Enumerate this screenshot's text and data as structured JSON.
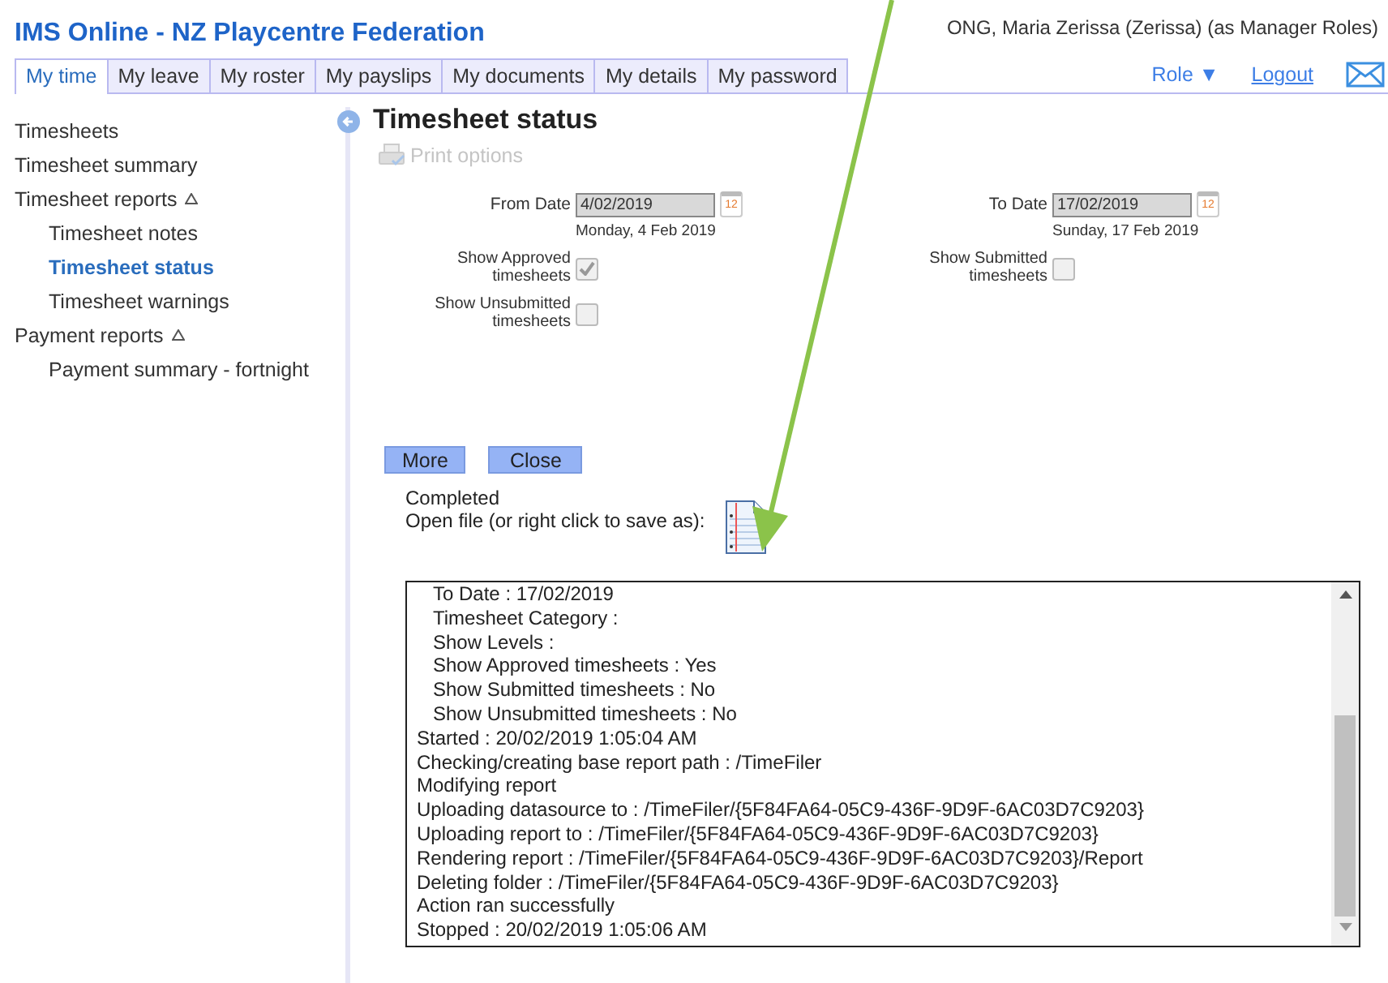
{
  "app_title": "IMS Online - NZ Playcentre Federation",
  "user": "ONG, Maria Zerissa (Zerissa) (as Manager Roles)",
  "tabs": [
    {
      "label": "My time",
      "selected": true
    },
    {
      "label": "My leave",
      "selected": false
    },
    {
      "label": "My roster",
      "selected": false
    },
    {
      "label": "My payslips",
      "selected": false
    },
    {
      "label": "My documents",
      "selected": false
    },
    {
      "label": "My details",
      "selected": false
    },
    {
      "label": "My password",
      "selected": false
    }
  ],
  "role_menu": {
    "label": "Role",
    "caret": "▼"
  },
  "logout": "Logout",
  "sidebar": {
    "items": [
      {
        "label": "Timesheets",
        "selected": false
      },
      {
        "label": "Timesheet summary",
        "selected": false
      },
      {
        "label": "Timesheet reports",
        "selected": false,
        "expanded": true,
        "children": [
          {
            "label": "Timesheet notes",
            "selected": false
          },
          {
            "label": "Timesheet status",
            "selected": true
          },
          {
            "label": "Timesheet warnings",
            "selected": false
          }
        ]
      },
      {
        "label": "Payment reports",
        "selected": false,
        "expanded": true,
        "children": [
          {
            "label": "Payment summary - fortnight",
            "selected": false
          }
        ]
      }
    ]
  },
  "page_title": "Timesheet status",
  "print_options": {
    "label": "Print options",
    "disabled": true
  },
  "form": {
    "from_date": {
      "label": "From Date",
      "value": "4/02/2019",
      "day": "Monday, 4 Feb 2019",
      "calendar": "12"
    },
    "to_date": {
      "label": "To Date",
      "value": "17/02/2019",
      "day": "Sunday, 17 Feb 2019",
      "calendar": "12"
    },
    "left_checkboxes": [
      {
        "label": "Show Approved timesheets",
        "checked": true,
        "disabled": true
      },
      {
        "label": "Show Unsubmitted timesheets",
        "checked": false,
        "disabled": true
      }
    ],
    "right_checkboxes": [
      {
        "label": "Show Submitted timesheets",
        "checked": false,
        "disabled": true
      }
    ]
  },
  "buttons": [
    "More",
    "Close"
  ],
  "status": "Completed",
  "open_file": "Open file (or right click to save as):",
  "log": [
    {
      "kind": "param",
      "text": "To Date : 17/02/2019"
    },
    {
      "kind": "param",
      "text": "Timesheet Category :"
    },
    {
      "kind": "param",
      "text": "Show Levels :"
    },
    {
      "kind": "param",
      "text": "Show Approved timesheets : Yes"
    },
    {
      "kind": "param",
      "text": "Show Submitted timesheets : No"
    },
    {
      "kind": "param",
      "text": "Show Unsubmitted timesheets : No"
    },
    {
      "kind": "step",
      "text": "Started : 20/02/2019 1:05:04 AM"
    },
    {
      "kind": "step",
      "text": "Checking/creating base report path : /TimeFiler"
    },
    {
      "kind": "step",
      "text": "Modifying report"
    },
    {
      "kind": "step",
      "text": "Uploading datasource to : /TimeFiler/{5F84FA64-05C9-436F-9D9F-6AC03D7C9203}"
    },
    {
      "kind": "step",
      "text": "Uploading report to : /TimeFiler/{5F84FA64-05C9-436F-9D9F-6AC03D7C9203}"
    },
    {
      "kind": "step",
      "text": "Rendering report : /TimeFiler/{5F84FA64-05C9-436F-9D9F-6AC03D7C9203}/Report"
    },
    {
      "kind": "step",
      "text": "Deleting folder : /TimeFiler/{5F84FA64-05C9-436F-9D9F-6AC03D7C9203}"
    },
    {
      "kind": "step",
      "text": "Action ran successfully"
    },
    {
      "kind": "step",
      "text": "Stopped : 20/02/2019 1:05:06 AM"
    }
  ]
}
